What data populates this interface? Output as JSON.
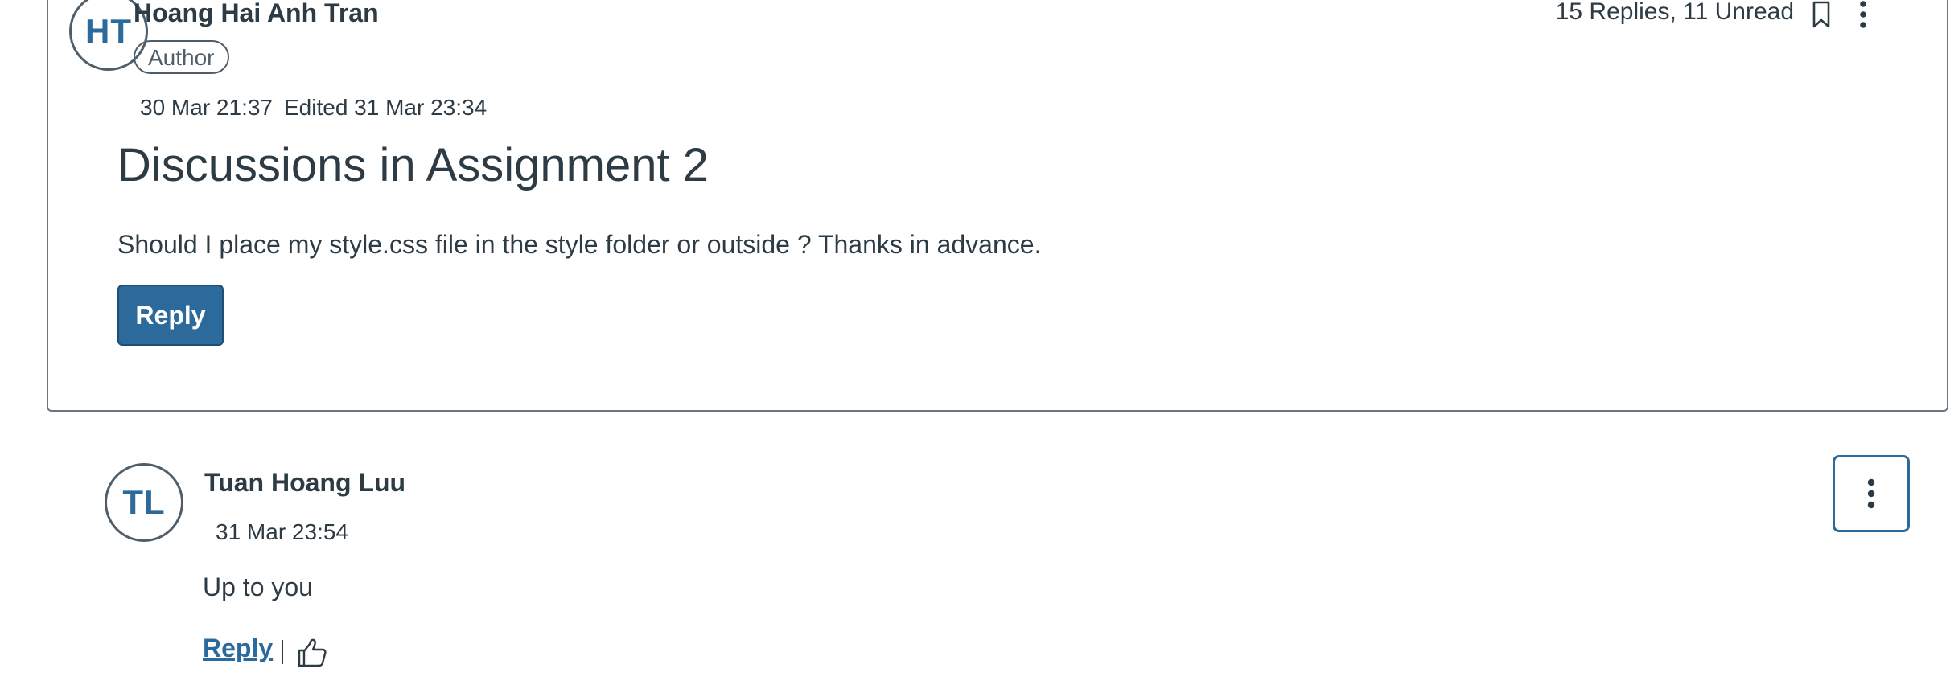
{
  "topic": {
    "avatar_initials": "HT",
    "author_name": "Hoang Hai Anh Tran",
    "author_role": "Author",
    "posted_at": "30 Mar 21:37",
    "edited_at": "Edited 31 Mar 23:34",
    "reply_count": "15 Replies, 11 Unread",
    "title": "Discussions in Assignment 2",
    "body": "Should I place my style.css file in the style folder or outside ? Thanks in advance.",
    "reply_button_label": "Reply",
    "icons": {
      "bookmark": "bookmark-icon",
      "more": "kebab-menu-icon"
    }
  },
  "entry": {
    "avatar_initials": "TL",
    "author_name": "Tuan Hoang Luu",
    "posted_at": "31 Mar 23:54",
    "message": "Up to you",
    "reply_link_label": "Reply",
    "icons": {
      "like": "thumbs-up-icon",
      "more": "kebab-menu-icon"
    }
  },
  "colors": {
    "accent": "#2b6a9a",
    "text": "#2d3b45",
    "border": "#6b7780"
  }
}
